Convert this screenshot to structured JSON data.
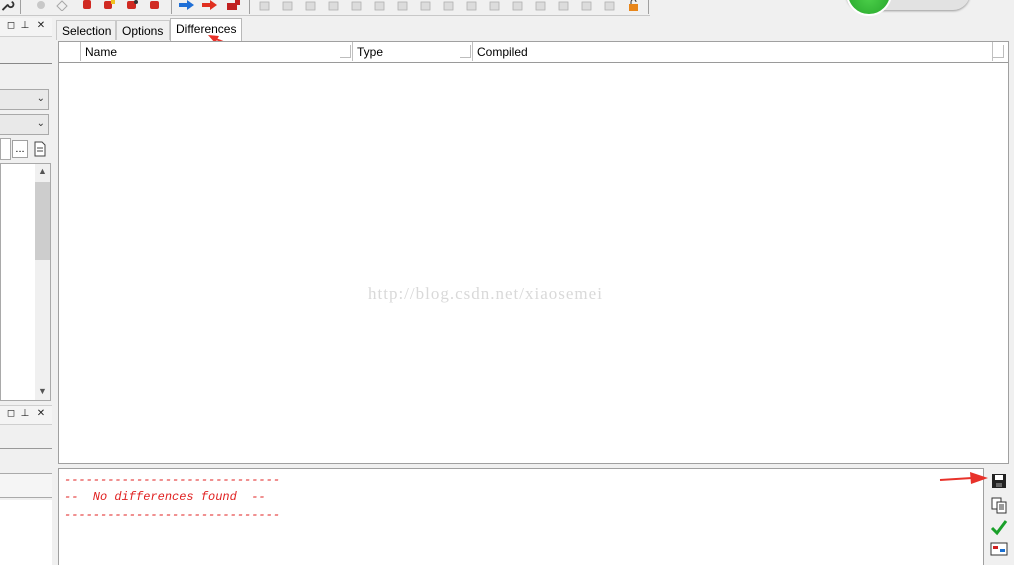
{
  "toolbar": {
    "icons": [
      "wrench-icon",
      "gear-gray-icon",
      "tag-gray-icon",
      "database-red-icon",
      "database-edit-red-icon",
      "database-alt-red-icon",
      "database-remove-red-icon",
      "arrow-right-blue-icon",
      "arrow-right-red-icon",
      "connect-red-icon",
      "compare-gray-icons",
      "lock-orange-icon"
    ]
  },
  "left_panel": {
    "window_controls": [
      "◻",
      "⊥",
      "✕"
    ],
    "browse_button": "...",
    "scroll_up": "▲",
    "scroll_down": "▼"
  },
  "tabs": [
    {
      "label": "Selection",
      "active": false
    },
    {
      "label": "Options",
      "active": false
    },
    {
      "label": "Differences",
      "active": true
    }
  ],
  "grid": {
    "columns": [
      "Name",
      "Type",
      "Compiled"
    ],
    "rows": []
  },
  "watermark": "http://blog.csdn.net/xiaosemei",
  "output": {
    "lines": [
      "------------------------------",
      "--  No differences found  --",
      "------------------------------"
    ]
  },
  "side_tools": [
    "save-icon",
    "copy-icon",
    "check-icon",
    "compare-icon"
  ],
  "colors": {
    "output_text": "#e02020",
    "annotation_arrow": "#e8322a",
    "indicator_green": "#2bb02e"
  }
}
